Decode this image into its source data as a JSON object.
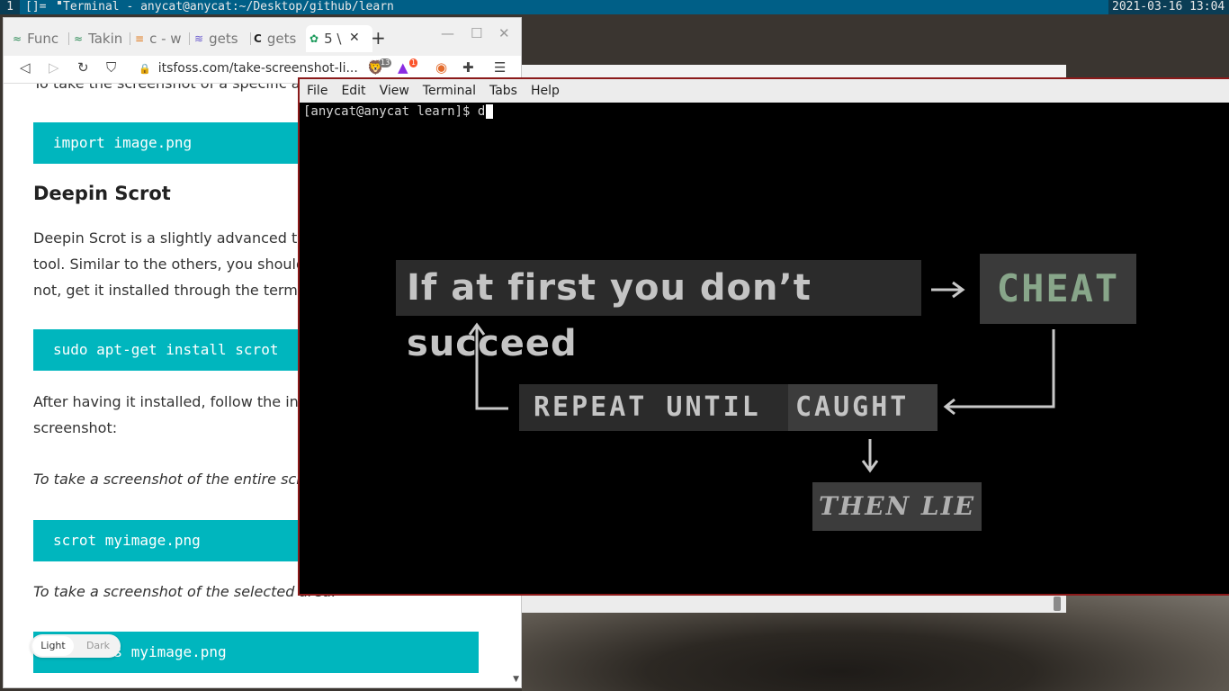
{
  "topbar": {
    "workspace": "1",
    "layout": "[]=",
    "window_title": "Terminal - anycat@anycat:~/Desktop/github/learn",
    "clock": "2021-03-16 13:04"
  },
  "browser": {
    "tabs": [
      {
        "label": "Func",
        "icon": "gg-icon"
      },
      {
        "label": "Takin",
        "icon": "gg-icon"
      },
      {
        "label": "c - w",
        "icon": "stackoverflow-icon"
      },
      {
        "label": "gets",
        "icon": "waves-icon"
      },
      {
        "label": "gets",
        "icon": "cplusplus-icon"
      },
      {
        "label": "5 \\",
        "icon": "gear-icon"
      }
    ],
    "url": "itsfoss.com/take-screenshot-li...",
    "badges": {
      "brave": "13",
      "rewards": "1"
    },
    "page": {
      "cut_text": "To take the screenshot of a specific area",
      "code1": "import image.png",
      "heading": "Deepin Scrot",
      "para1_line1": "Deepin Scrot is a slightly advanced term",
      "para1_line2": "tool. Similar to the others, you should a",
      "para1_line3": "not, get it installed through the termina",
      "code2": "sudo apt-get install scrot",
      "para2_line1": "After having it installed, follow the instru",
      "para2_line2": "screenshot:",
      "italic1": "To take a screenshot of the entire screen:",
      "code3": "scrot myimage.png",
      "italic2": "To take a screenshot of the selected area:",
      "code4": "scrot -s myimage.png",
      "theme_light": "Light",
      "theme_dark": "Dark"
    }
  },
  "terminal": {
    "menu": [
      "File",
      "Edit",
      "View",
      "Terminal",
      "Tabs",
      "Help"
    ],
    "prompt": "[anycat@anycat learn]$ d",
    "meme": {
      "box1": "If at first you don’t succeed",
      "box2": "CHEAT",
      "box3": "REPEAT UNTIL",
      "box4": "CAUGHT",
      "box5": "THEN LIE"
    }
  }
}
